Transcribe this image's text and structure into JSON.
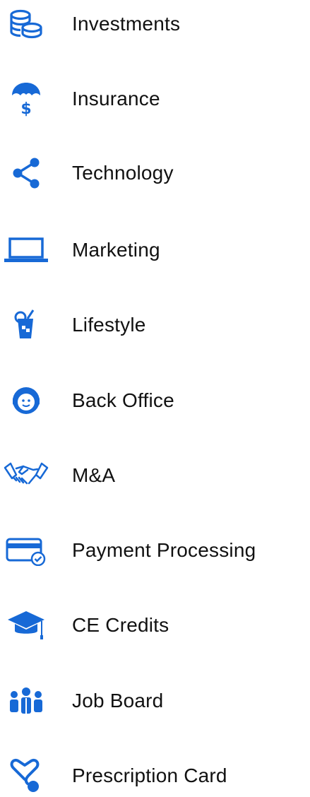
{
  "accent_color": "#1769d6",
  "menu": {
    "items": [
      {
        "label": "Investments",
        "icon": "coins-stack-icon"
      },
      {
        "label": "Insurance",
        "icon": "umbrella-dollar-icon"
      },
      {
        "label": "Technology",
        "icon": "share-nodes-icon"
      },
      {
        "label": "Marketing",
        "icon": "laptop-icon"
      },
      {
        "label": "Lifestyle",
        "icon": "drink-icon"
      },
      {
        "label": "Back Office",
        "icon": "headset-support-icon"
      },
      {
        "label": "M&A",
        "icon": "handshake-icon"
      },
      {
        "label": "Payment Processing",
        "icon": "credit-card-check-icon"
      },
      {
        "label": "CE Credits",
        "icon": "graduation-cap-icon"
      },
      {
        "label": "Job Board",
        "icon": "team-people-icon"
      },
      {
        "label": "Prescription Card",
        "icon": "stethoscope-heart-icon"
      }
    ]
  }
}
